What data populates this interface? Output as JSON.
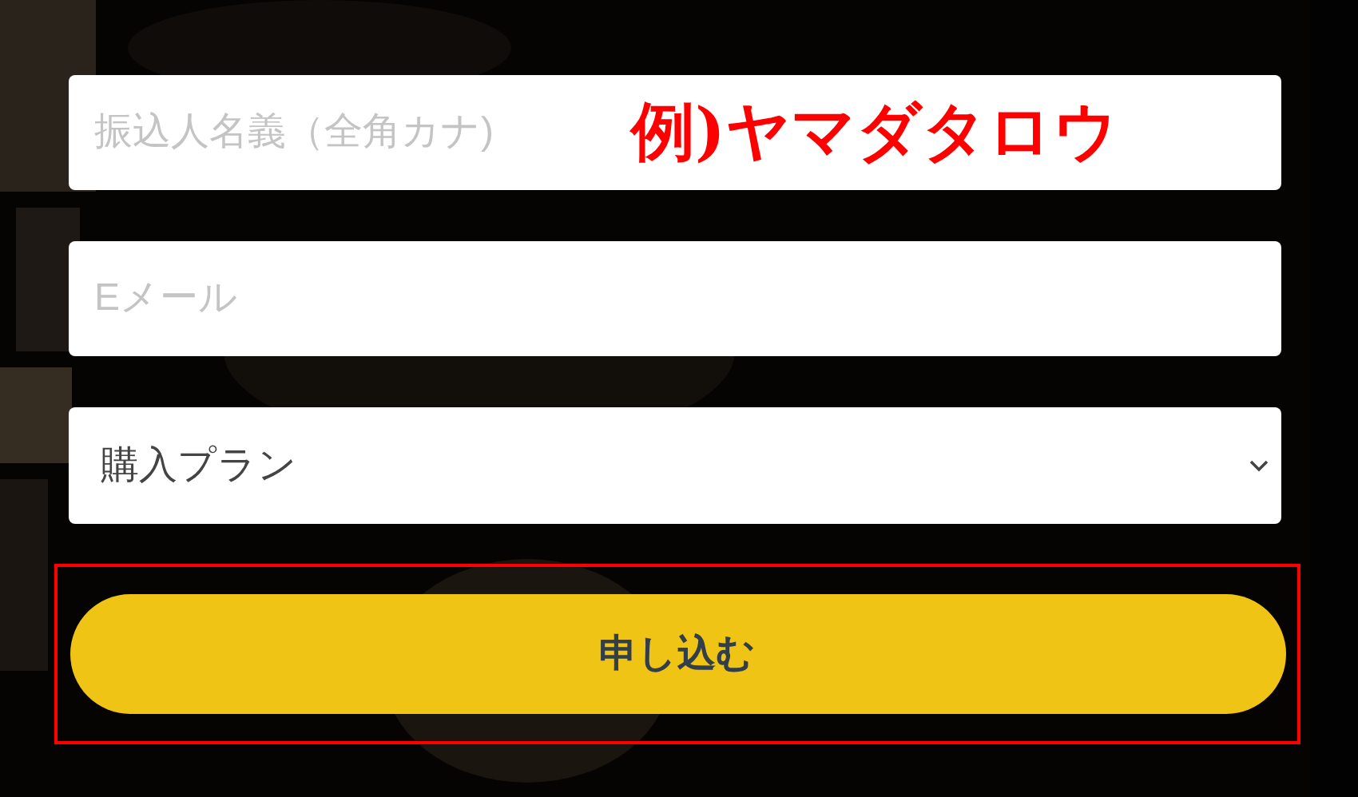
{
  "form": {
    "fields": [
      {
        "kind": "text",
        "placeholder": "振込人名義（全角カナ)"
      },
      {
        "kind": "text",
        "placeholder": "Eメール"
      },
      {
        "kind": "select",
        "value": "購入プラン"
      }
    ],
    "submit": {
      "label": "申し込む"
    }
  },
  "annotations": {
    "example_note": "例)ヤマダタロウ",
    "highlight_submit": true
  }
}
